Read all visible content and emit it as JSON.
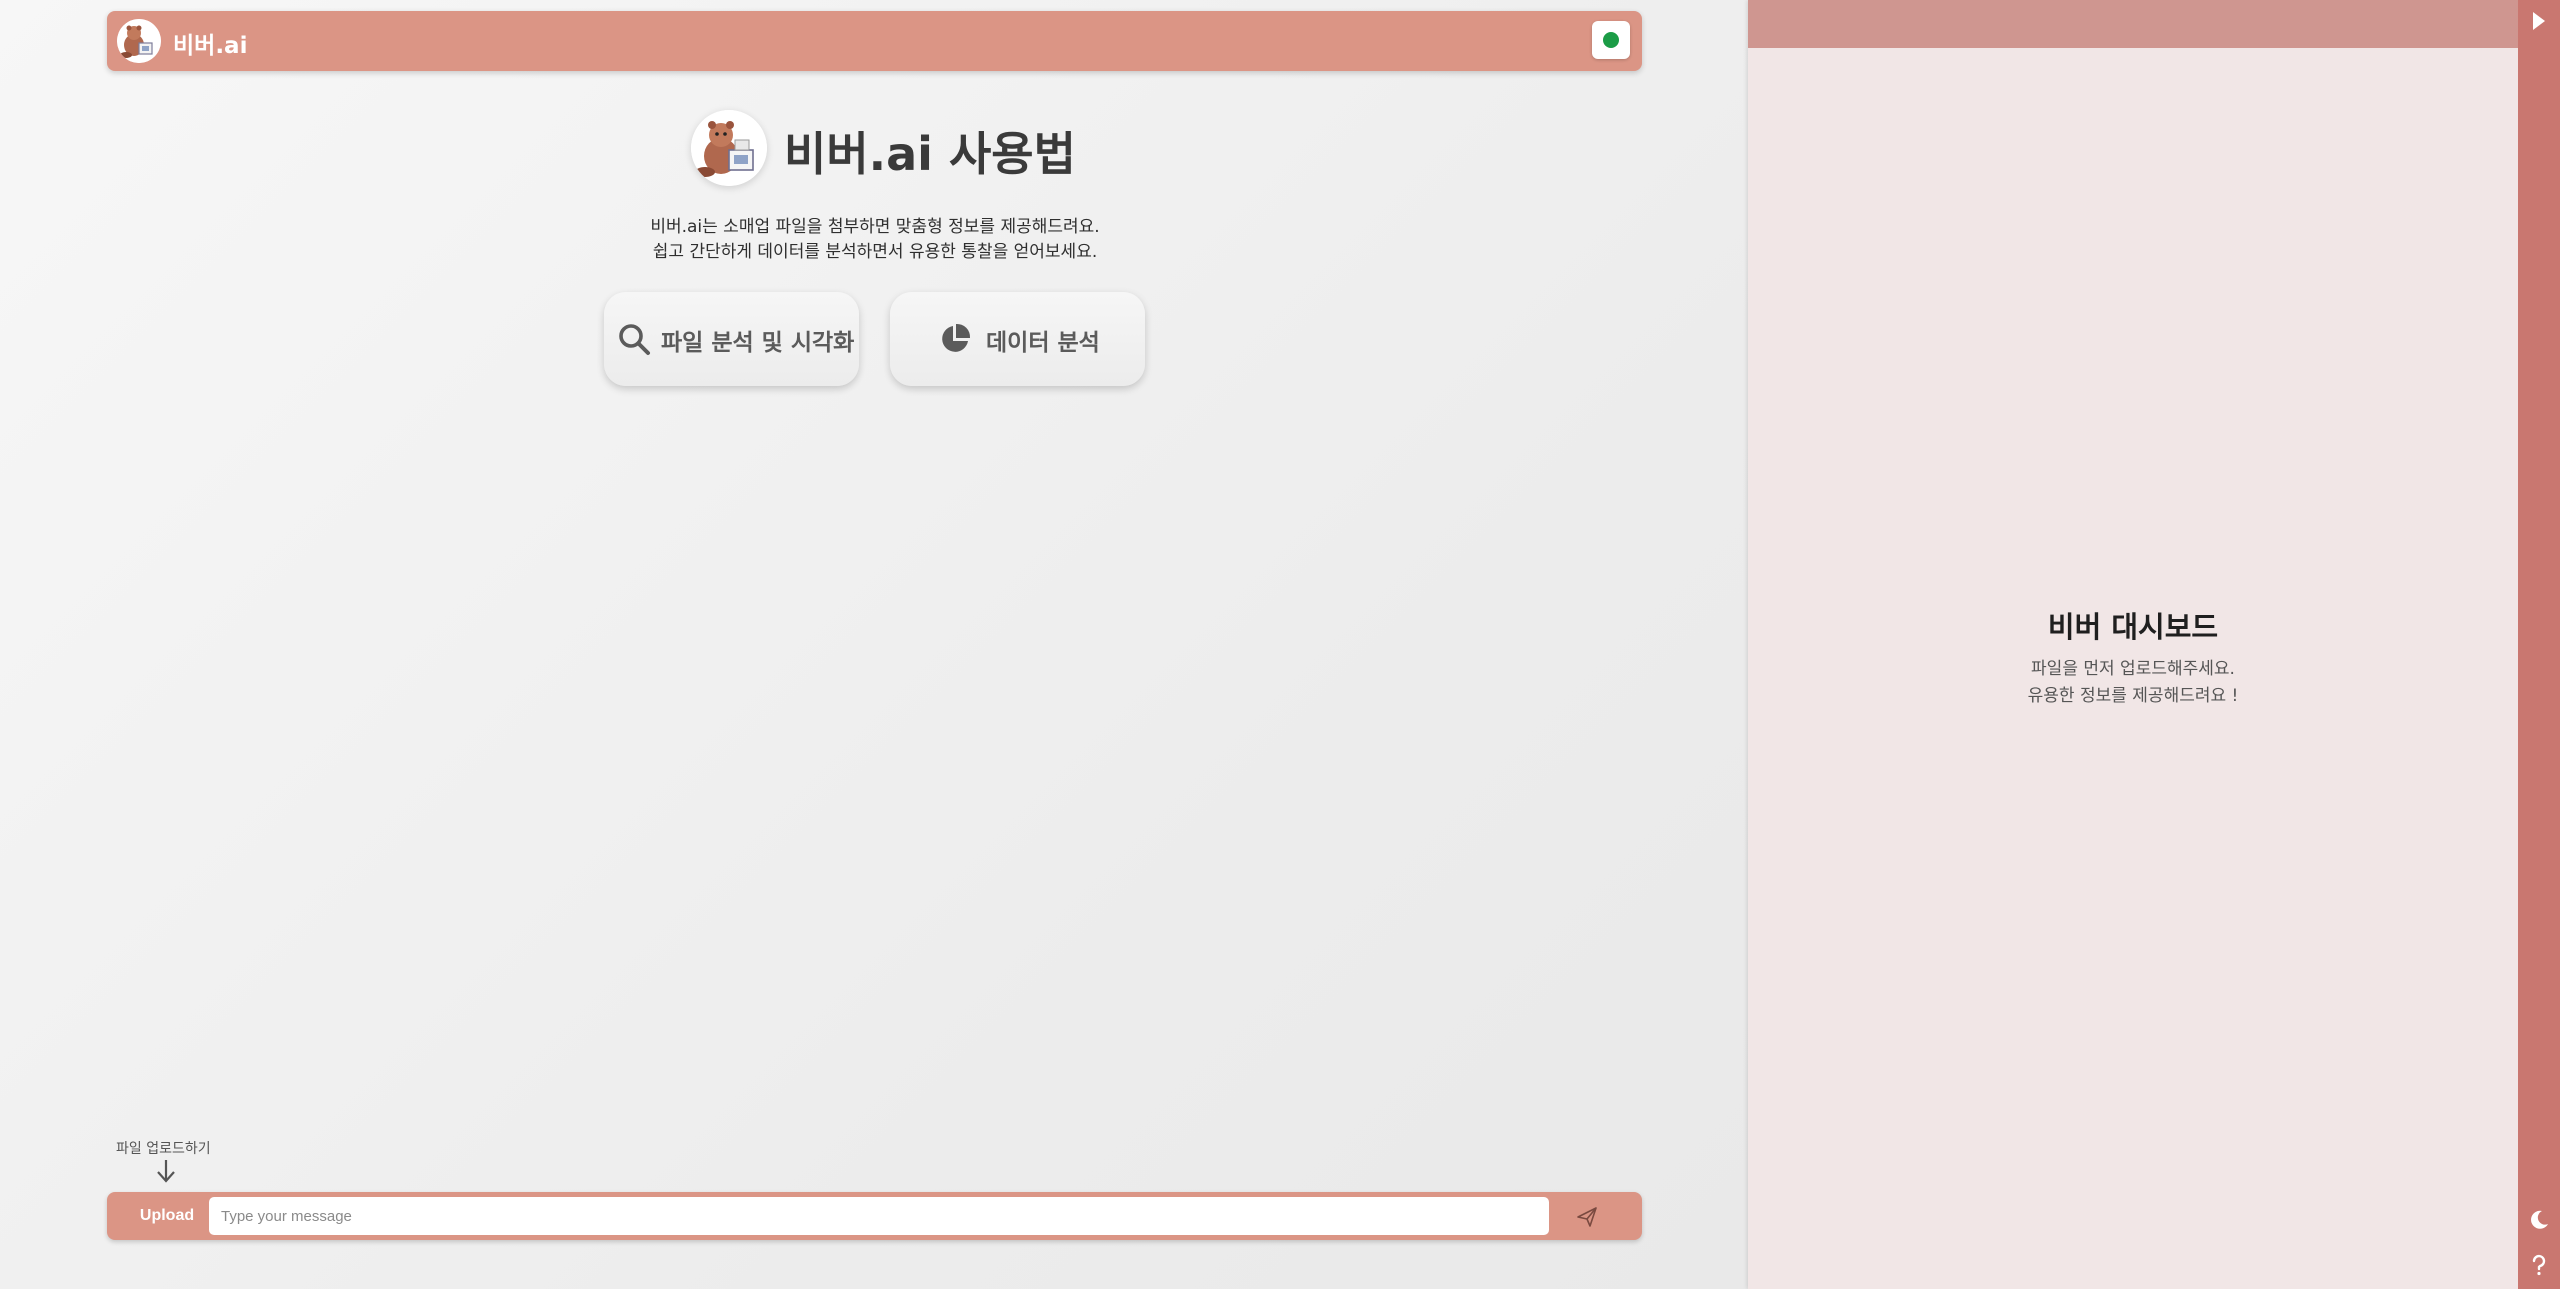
{
  "header": {
    "brand": "비버.ai",
    "status_color": "#1b9c46"
  },
  "hero": {
    "title": "비버.ai 사용법",
    "description_lines": [
      "비버.ai는 소매업 파일을 첨부하면 맞춤형 정보를 제공해드려요.",
      "쉽고 간단하게 데이터를 분석하면서 유용한 통찰을 얻어보세요."
    ]
  },
  "cards": [
    {
      "label": "파일 분석 및 시각화",
      "icon": "search-icon"
    },
    {
      "label": "데이터 분석",
      "icon": "pie-chart-icon"
    }
  ],
  "composer": {
    "upload_hint": "파일 업로드하기",
    "upload_label": "Upload",
    "placeholder": "Type your message",
    "value": ""
  },
  "dashboard": {
    "title": "비버 대시보드",
    "subtitle_lines": [
      "파일을 먼저 업로드해주세요.",
      "유용한 정보를 제공해드려요 !"
    ]
  },
  "sidebar_buttons": [
    "expand-icon",
    "moon-icon",
    "help-icon"
  ],
  "colors": {
    "accent": "#db9585",
    "panel_header": "#cf9690",
    "panel_bg": "#f1e6e6",
    "strip": "#c97770",
    "online": "#1b9c46"
  }
}
